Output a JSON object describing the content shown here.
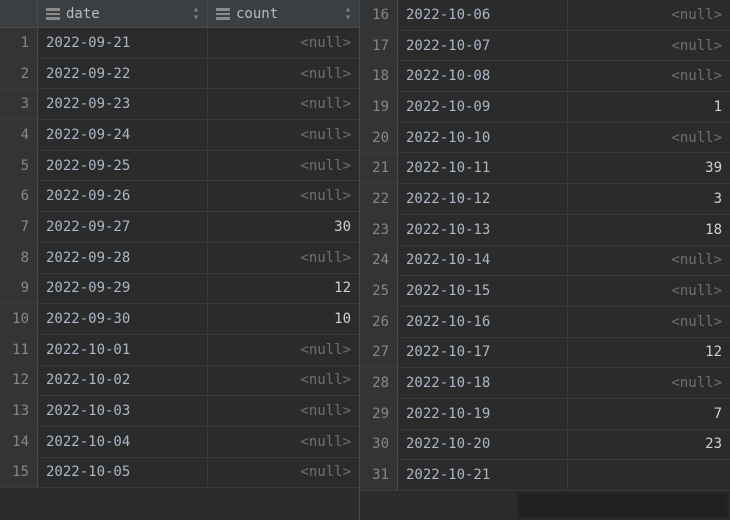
{
  "columns": {
    "date_label": "date",
    "count_label": "count"
  },
  "null_text": "<null>",
  "left_rows": [
    {
      "n": "1",
      "date": "2022-09-21",
      "count": null
    },
    {
      "n": "2",
      "date": "2022-09-22",
      "count": null
    },
    {
      "n": "3",
      "date": "2022-09-23",
      "count": null
    },
    {
      "n": "4",
      "date": "2022-09-24",
      "count": null
    },
    {
      "n": "5",
      "date": "2022-09-25",
      "count": null
    },
    {
      "n": "6",
      "date": "2022-09-26",
      "count": null
    },
    {
      "n": "7",
      "date": "2022-09-27",
      "count": "30"
    },
    {
      "n": "8",
      "date": "2022-09-28",
      "count": null
    },
    {
      "n": "9",
      "date": "2022-09-29",
      "count": "12"
    },
    {
      "n": "10",
      "date": "2022-09-30",
      "count": "10"
    },
    {
      "n": "11",
      "date": "2022-10-01",
      "count": null
    },
    {
      "n": "12",
      "date": "2022-10-02",
      "count": null
    },
    {
      "n": "13",
      "date": "2022-10-03",
      "count": null
    },
    {
      "n": "14",
      "date": "2022-10-04",
      "count": null
    },
    {
      "n": "15",
      "date": "2022-10-05",
      "count": null
    }
  ],
  "right_rows": [
    {
      "n": "16",
      "date": "2022-10-06",
      "count": null
    },
    {
      "n": "17",
      "date": "2022-10-07",
      "count": null
    },
    {
      "n": "18",
      "date": "2022-10-08",
      "count": null
    },
    {
      "n": "19",
      "date": "2022-10-09",
      "count": "1"
    },
    {
      "n": "20",
      "date": "2022-10-10",
      "count": null
    },
    {
      "n": "21",
      "date": "2022-10-11",
      "count": "39"
    },
    {
      "n": "22",
      "date": "2022-10-12",
      "count": "3"
    },
    {
      "n": "23",
      "date": "2022-10-13",
      "count": "18"
    },
    {
      "n": "24",
      "date": "2022-10-14",
      "count": null
    },
    {
      "n": "25",
      "date": "2022-10-15",
      "count": null
    },
    {
      "n": "26",
      "date": "2022-10-16",
      "count": null
    },
    {
      "n": "27",
      "date": "2022-10-17",
      "count": "12"
    },
    {
      "n": "28",
      "date": "2022-10-18",
      "count": null
    },
    {
      "n": "29",
      "date": "2022-10-19",
      "count": "7"
    },
    {
      "n": "30",
      "date": "2022-10-20",
      "count": "23"
    },
    {
      "n": "31",
      "date": "2022-10-21",
      "count": ""
    }
  ]
}
